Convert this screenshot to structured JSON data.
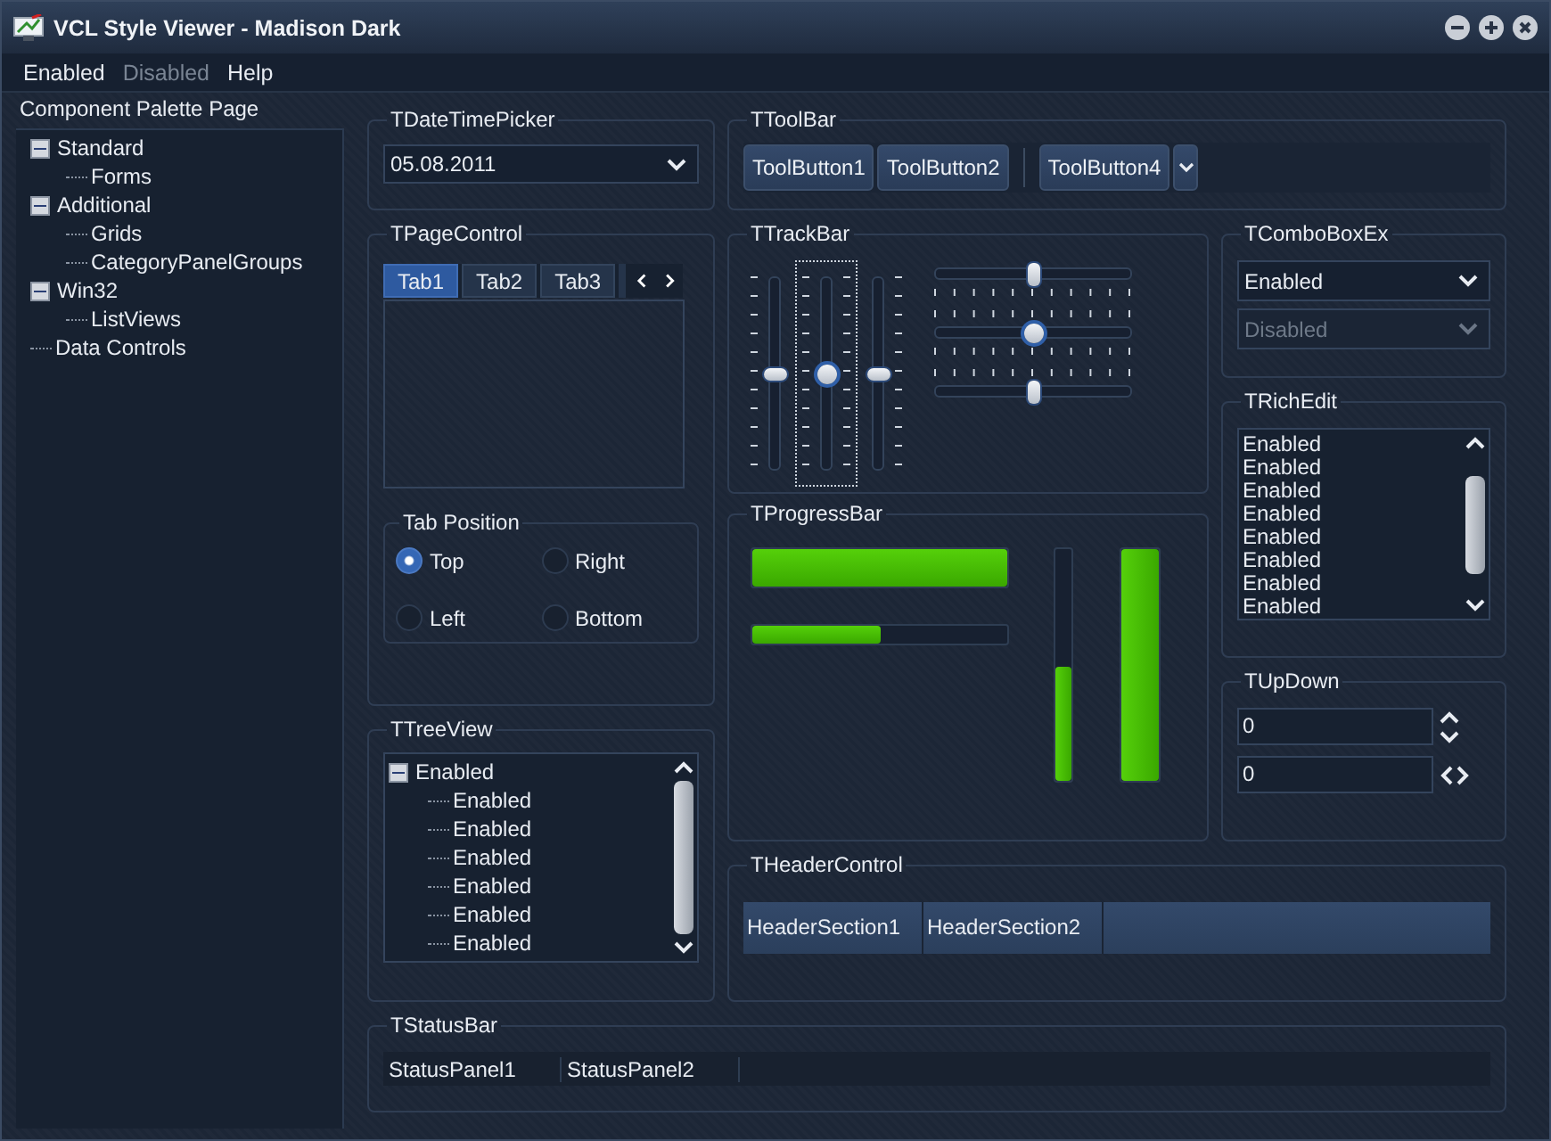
{
  "window": {
    "title": "VCL Style Viewer - Madison Dark"
  },
  "menu": [
    {
      "label": "Enabled",
      "disabled": false
    },
    {
      "label": "Disabled",
      "disabled": true
    },
    {
      "label": "Help",
      "disabled": false
    }
  ],
  "palette": {
    "title": "Component Palette Page",
    "items": [
      {
        "label": "Standard",
        "expanded": true,
        "children": [
          {
            "label": "Forms"
          }
        ]
      },
      {
        "label": "Additional",
        "expanded": true,
        "children": [
          {
            "label": "Grids"
          },
          {
            "label": "CategoryPanelGroups"
          }
        ]
      },
      {
        "label": "Win32",
        "expanded": true,
        "children": [
          {
            "label": "ListViews"
          }
        ]
      },
      {
        "label": "Data Controls"
      }
    ]
  },
  "date_time_picker": {
    "title": "TDateTimePicker",
    "value": "05.08.2011"
  },
  "toolbar": {
    "title": "TToolBar",
    "buttons": [
      {
        "label": "ToolButton1",
        "separator_before": false
      },
      {
        "label": "ToolButton2",
        "separator_before": false
      },
      {
        "label": "ToolButton4",
        "separator_before": true
      }
    ]
  },
  "page_control": {
    "title": "TPageControl",
    "tabs": [
      {
        "label": "Tab1",
        "selected": true
      },
      {
        "label": "Tab2",
        "selected": false
      },
      {
        "label": "Tab3",
        "selected": false
      }
    ],
    "tab_position": {
      "title": "Tab Position",
      "options": [
        {
          "label": "Top",
          "selected": true
        },
        {
          "label": "Right",
          "selected": false
        },
        {
          "label": "Left",
          "selected": false
        },
        {
          "label": "Bottom",
          "selected": false
        }
      ]
    }
  },
  "track_bar": {
    "title": "TTrackBar",
    "sliders": [
      {
        "kind": "vertical",
        "level": 0.5,
        "focused": false
      },
      {
        "kind": "vertical",
        "level": 0.5,
        "focused": true
      },
      {
        "kind": "vertical",
        "level": 0.5,
        "focused": false
      },
      {
        "kind": "horizontal",
        "level": 0.5
      },
      {
        "kind": "horizontal",
        "level": 0.5
      },
      {
        "kind": "horizontal",
        "level": 0.5
      }
    ]
  },
  "progress_bar": {
    "title": "TProgressBar",
    "bars": [
      {
        "kind": "horizontal",
        "level": 1.0
      },
      {
        "kind": "horizontal",
        "level": 0.5
      },
      {
        "kind": "vertical",
        "level": 0.49
      },
      {
        "kind": "vertical",
        "level": 1.0
      }
    ]
  },
  "combo_box_ex": {
    "title": "TComboBoxEx",
    "combos": [
      {
        "value": "Enabled",
        "disabled": false
      },
      {
        "value": "Disabled",
        "disabled": true
      }
    ]
  },
  "rich_edit": {
    "title": "TRichEdit",
    "lines": [
      "Enabled",
      "Enabled",
      "Enabled",
      "Enabled",
      "Enabled",
      "Enabled",
      "Enabled",
      "Enabled"
    ]
  },
  "up_down": {
    "title": "TUpDown",
    "fields": [
      {
        "value": "0",
        "kind": "vertical"
      },
      {
        "value": "0",
        "kind": "horizontal"
      }
    ]
  },
  "tree_view": {
    "title": "TTreeView",
    "root": {
      "label": "Enabled",
      "expanded": true,
      "children": [
        {
          "label": "Enabled"
        },
        {
          "label": "Enabled"
        },
        {
          "label": "Enabled"
        },
        {
          "label": "Enabled"
        },
        {
          "label": "Enabled"
        },
        {
          "label": "Enabled"
        }
      ]
    }
  },
  "header_control": {
    "title": "THeaderControl",
    "sections": [
      "HeaderSection1",
      "HeaderSection2"
    ]
  },
  "status_bar": {
    "title": "TStatusBar",
    "panels": [
      "StatusPanel1",
      "StatusPanel2"
    ]
  }
}
